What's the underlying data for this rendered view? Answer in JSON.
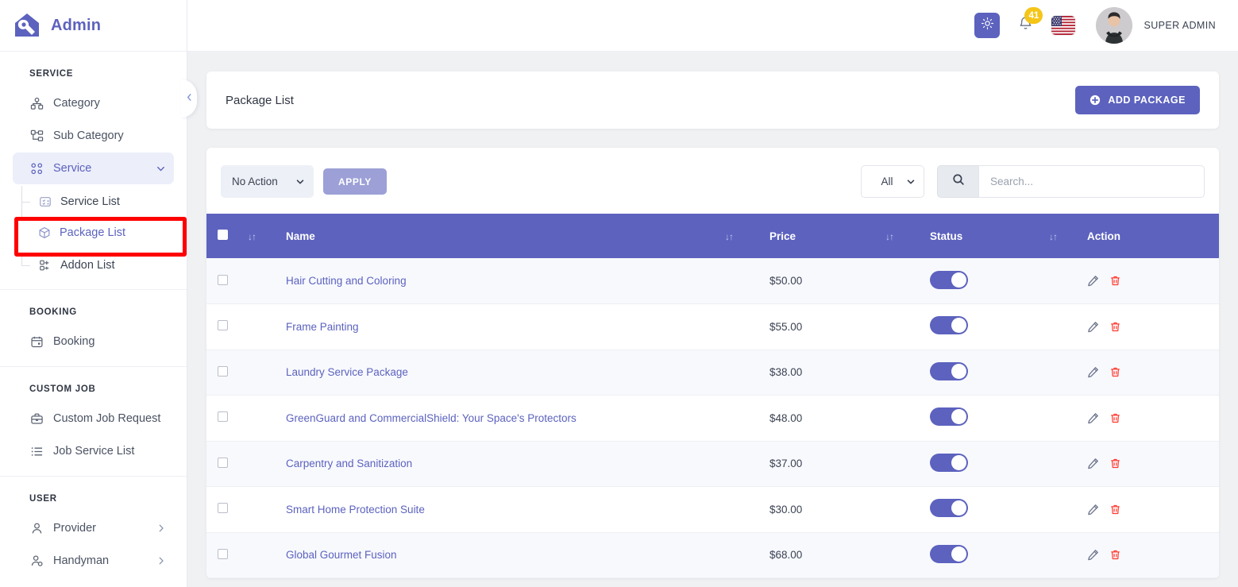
{
  "brand": {
    "name": "Admin",
    "logo_icon": "house-wrench-logo"
  },
  "sidebar": {
    "collapse_icon": "chevron-left-icon",
    "sections": [
      {
        "title": "SERVICE",
        "items": [
          {
            "label": "Category",
            "icon": "category-icon",
            "active": false,
            "expandable": false
          },
          {
            "label": "Sub Category",
            "icon": "sub-category-icon",
            "active": false,
            "expandable": false
          },
          {
            "label": "Service",
            "icon": "grid-icon",
            "active": true,
            "expandable": true,
            "chevron": "chevron-down-icon"
          }
        ],
        "submenu": [
          {
            "label": "Service List",
            "icon": "service-list-icon",
            "highlighted": false
          },
          {
            "label": "Package List",
            "icon": "package-icon",
            "highlighted": true
          },
          {
            "label": "Addon List",
            "icon": "addon-icon",
            "highlighted": false
          }
        ]
      },
      {
        "title": "BOOKING",
        "items": [
          {
            "label": "Booking",
            "icon": "calendar-icon",
            "active": false,
            "expandable": false
          }
        ],
        "submenu": []
      },
      {
        "title": "CUSTOM JOB",
        "items": [
          {
            "label": "Custom Job Request",
            "icon": "briefcase-icon",
            "active": false,
            "expandable": false
          },
          {
            "label": "Job Service List",
            "icon": "list-icon",
            "active": false,
            "expandable": false
          }
        ],
        "submenu": []
      },
      {
        "title": "USER",
        "items": [
          {
            "label": "Provider",
            "icon": "user-icon",
            "active": false,
            "expandable": true,
            "chevron": "chevron-right-icon"
          },
          {
            "label": "Handyman",
            "icon": "handyman-user-icon",
            "active": false,
            "expandable": true,
            "chevron": "chevron-right-icon"
          }
        ],
        "submenu": []
      }
    ]
  },
  "topbar": {
    "theme_icon": "sun-icon",
    "notification_icon": "bell-icon",
    "notification_count": "41",
    "flag_icon": "us-flag-icon",
    "avatar_icon": "user-avatar",
    "username": "SUPER ADMIN"
  },
  "page": {
    "title": "Package List",
    "add_button_label": "ADD PACKAGE",
    "add_button_icon": "plus-circle-icon"
  },
  "toolbar": {
    "bulk_action_value": "No Action",
    "bulk_action_options": [
      "No Action"
    ],
    "apply_label": "APPLY",
    "filter_value": "All",
    "filter_options": [
      "All"
    ],
    "search_icon": "search-icon",
    "search_value": "",
    "search_placeholder": "Search..."
  },
  "table": {
    "sort_icon": "sort-updown-icon",
    "columns": [
      {
        "key": "check",
        "label": ""
      },
      {
        "key": "name",
        "label": "Name"
      },
      {
        "key": "price",
        "label": "Price"
      },
      {
        "key": "status",
        "label": "Status"
      },
      {
        "key": "action",
        "label": "Action"
      }
    ],
    "edit_icon": "pencil-icon",
    "delete_icon": "trash-icon",
    "rows": [
      {
        "name": "Hair Cutting and Coloring",
        "price": "$50.00",
        "status": true
      },
      {
        "name": "Frame Painting",
        "price": "$55.00",
        "status": true
      },
      {
        "name": "Laundry Service Package",
        "price": "$38.00",
        "status": true
      },
      {
        "name": "GreenGuard and CommercialShield: Your Space's Protectors",
        "price": "$48.00",
        "status": true
      },
      {
        "name": "Carpentry and Sanitization",
        "price": "$37.00",
        "status": true
      },
      {
        "name": "Smart Home Protection Suite",
        "price": "$30.00",
        "status": true
      },
      {
        "name": "Global Gourmet Fusion",
        "price": "$68.00",
        "status": true
      }
    ]
  },
  "colors": {
    "primary": "#5c62be",
    "apply_button": "#9ca0d6",
    "badge": "#f5c518",
    "delete": "#ff3b30",
    "annotation": "#ff0000",
    "row_alt": "#f8f9fd",
    "page_bg": "#f0f1f3"
  }
}
